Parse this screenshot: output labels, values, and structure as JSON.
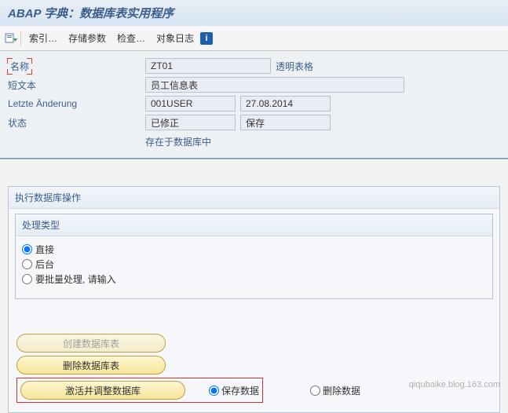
{
  "title": "ABAP 字典：数据库表实用程序",
  "toolbar": {
    "index": "索引…",
    "save_params": "存储参数",
    "check": "检查…",
    "object_log": "对象日志"
  },
  "info": {
    "name_label": "名称",
    "name_value": "ZT01",
    "type_text": "透明表格",
    "short_label": "短文本",
    "short_value": "员工信息表",
    "change_label": "Letzte Änderung",
    "change_user": "001USER",
    "change_date": "27.08.2014",
    "status_label": "状态",
    "status_value": "已修正",
    "saved_value": "保存",
    "db_text": "存在于数据库中"
  },
  "exec": {
    "title": "执行数据库操作",
    "proc_title": "处理类型",
    "opt_direct": "直接",
    "opt_bg": "后台",
    "opt_batch": "要批量处理, 请输入"
  },
  "buttons": {
    "create": "创建数据库表",
    "delete": "删除数据库表",
    "activate": "激活并调整数据库",
    "save_data": "保存数据",
    "del_data": "删除数据"
  },
  "footer": "qiqubaike.blog.163.com"
}
